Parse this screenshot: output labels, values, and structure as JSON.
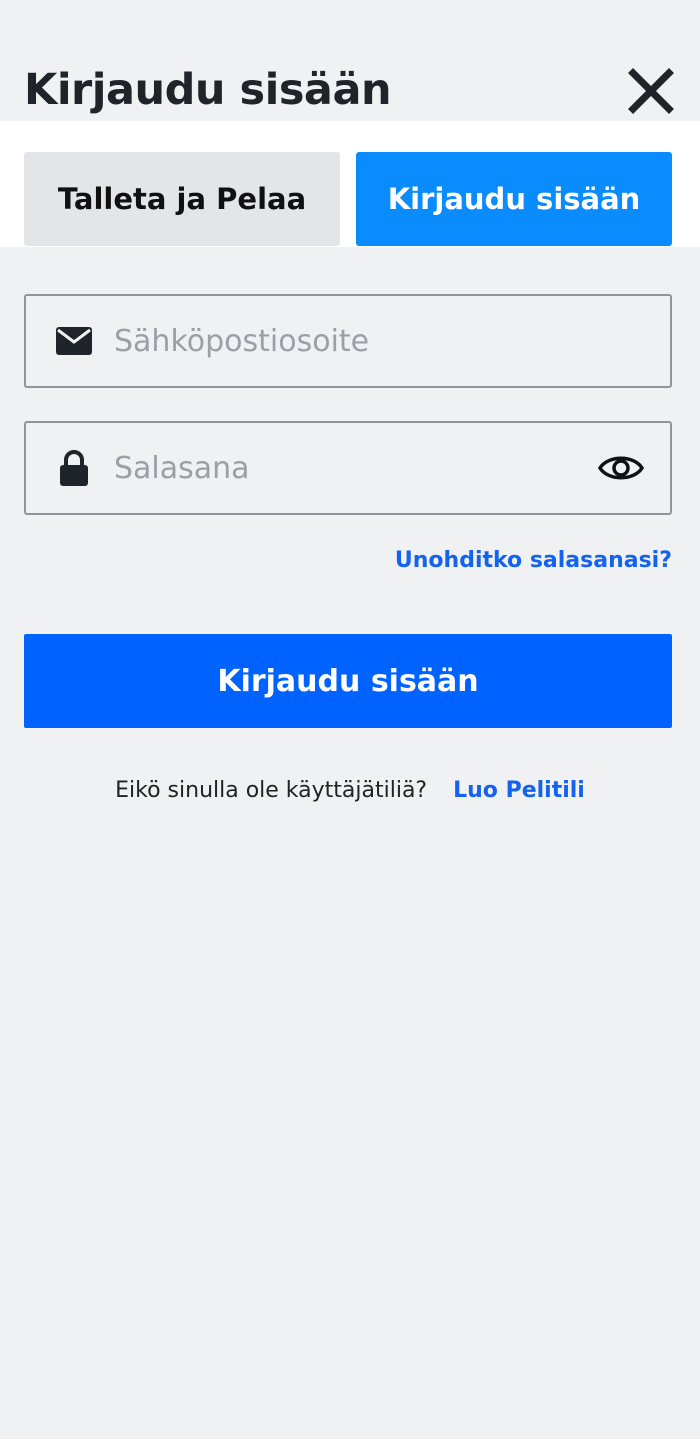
{
  "header": {
    "title": "Kirjaudu sisään",
    "close_icon": "close-icon"
  },
  "tabs": [
    {
      "label": "Talleta ja Pelaa",
      "active": false
    },
    {
      "label": "Kirjaudu sisään",
      "active": true
    }
  ],
  "form": {
    "email": {
      "placeholder": "Sähköpostiosoite",
      "value": "",
      "icon": "envelope-icon"
    },
    "password": {
      "placeholder": "Salasana",
      "value": "",
      "icon": "lock-icon",
      "toggle_icon": "eye-icon"
    },
    "forgot_label": "Unohditko salasanasi?",
    "submit_label": "Kirjaudu sisään"
  },
  "signup": {
    "prompt": "Eikö sinulla ole käyttäjätiliä?",
    "link_label": "Luo Pelitili"
  },
  "colors": {
    "background": "#f0f1f3",
    "active_tab": "#0a8cff",
    "inactive_tab": "#e3e5e8",
    "primary_button": "#0062ff",
    "link": "#1463f0",
    "text": "#1f242b"
  }
}
